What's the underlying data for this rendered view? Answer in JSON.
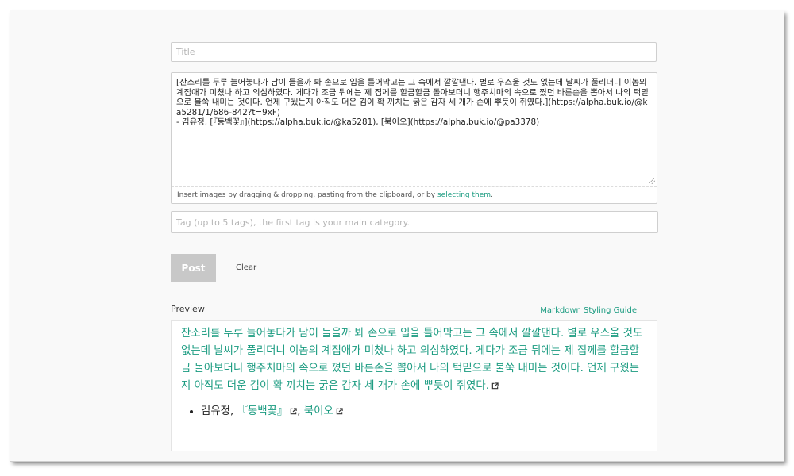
{
  "editor": {
    "title_placeholder": "Title",
    "body_text": "[잔소리를 두루 늘어놓다가 남이 들을까 봐 손으로 입을 틀어막고는 그 속에서 깔깔댄다. 별로 우스울 것도 없는데 날씨가 풀리더니 이놈의 계집애가 미쳤나 하고 의심하였다. 게다가 조금 뒤에는 제 집께를 할금할금 돌아보더니 행주치마의 속으로 꼈던 바른손을 뽑아서 나의 턱밑으로 불쑥 내미는 것이다. 언제 구웠는지 아직도 더운 김이 확 끼치는 굵은 감자 세 개가 손에 뿌듯이 쥐였다.](https://alpha.buk.io/@ka5281/1/686-842?t=9xF)\n- 김유정, [『동백꽃』](https://alpha.buk.io/@ka5281), [북이오](https://alpha.buk.io/@pa3378)",
    "upload_hint_prefix": "Insert images by dragging & dropping, pasting from the clipboard, or by ",
    "upload_hint_link": "selecting them",
    "upload_hint_suffix": ".",
    "tags_placeholder": "Tag (up to 5 tags), the first tag is your main category.",
    "post_label": "Post",
    "clear_label": "Clear"
  },
  "preview": {
    "label": "Preview",
    "guide_link": "Markdown Styling Guide",
    "paragraph": "잔소리를 두루 늘어놓다가 남이 들을까 봐 손으로 입을 틀어막고는 그 속에서 깔깔댄다. 별로 우스울 것도 없는데 날씨가 풀리더니 이놈의 계집애가 미쳤나 하고 의심하였다. 게다가 조금 뒤에는 제 집께를 할금할금 돌아보더니 행주치마의 속으로 꼈던 바른손을 뽑아서 나의 턱밑으로 불쑥 내미는 것이다. 언제 구웠는지 아직도 더운 김이 확 끼치는 굵은 감자 세 개가 손에 뿌듯이 쥐였다.",
    "list_author": "김유정, ",
    "list_link1": "『동백꽃』",
    "list_sep": ", ",
    "list_link2": "북이오"
  },
  "colors": {
    "accent": "#1a9b80",
    "post_button_bg": "#c8c8c8"
  }
}
